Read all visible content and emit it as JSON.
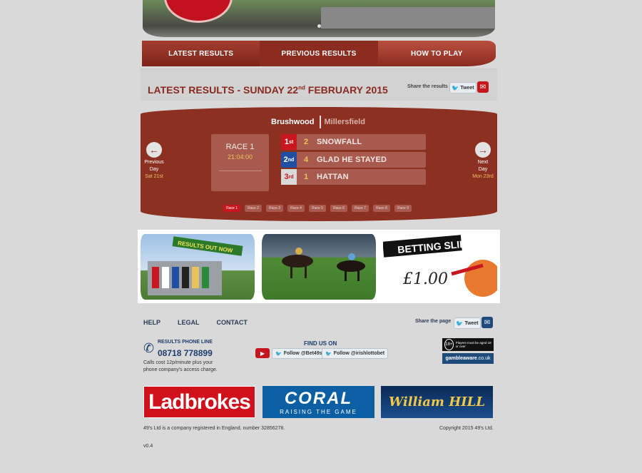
{
  "nav": {
    "tabs": [
      {
        "label": "LATEST RESULTS"
      },
      {
        "label": "PREVIOUS RESULTS"
      },
      {
        "label": "HOW TO PLAY"
      }
    ]
  },
  "latest": {
    "title_prefix": "LATEST RESULTS - ",
    "title_day": "SUNDAY 22",
    "title_sup": "nd",
    "title_rest": " FEBRUARY 2015",
    "share_label": "Share the results",
    "tweet_label": "Tweet"
  },
  "results": {
    "tracks": {
      "active": "Brushwood",
      "inactive": "Millersfield"
    },
    "prev": {
      "line1": "Previous",
      "line2": "Day",
      "date": "Sat 21st"
    },
    "next": {
      "line1": "Next",
      "line2": "Day",
      "date": "Mon 23rd"
    },
    "race": {
      "name": "RACE 1",
      "time": "21:04:00"
    },
    "places": [
      {
        "pos": "1",
        "sup": "st",
        "number": "2",
        "name": "SNOWFALL",
        "color": "#c9161f"
      },
      {
        "pos": "2",
        "sup": "nd",
        "number": "4",
        "name": "GLAD HE STAYED",
        "color": "#1f4fa0"
      },
      {
        "pos": "3",
        "sup": "rd",
        "number": "1",
        "name": "HATTAN",
        "color": "#d9d9d9"
      }
    ],
    "race_links": [
      "Race 1",
      "Race 2",
      "Race 3",
      "Race 4",
      "Race 5",
      "Race 6",
      "Race 7",
      "Race 8",
      "Race 9"
    ]
  },
  "promo": {
    "sign_text": "RESULTS OUT NOW",
    "slip_title": "BETTING SLIP",
    "slip_amount": "£1.00"
  },
  "footer": {
    "links": [
      "HELP",
      "LEGAL",
      "CONTACT"
    ],
    "share_label": "Share the page",
    "tweet_label": "Tweet",
    "phone_title": "RESULTS PHONE LINE",
    "phone_number": "08718 778899",
    "phone_note": "Calls cost 12p/minute plus your phone company's access charge.",
    "find_us": "FIND US ON",
    "follow1": "Follow @Bet49s",
    "follow2": "Follow @irishlottobet",
    "age_badge": "18+",
    "age_text": "Players must be aged 18 or over",
    "gamble_label": "gambleaware",
    "gamble_suffix": ".co.uk",
    "brands": {
      "ladbrokes": "Ladbrokes",
      "coral": "CORAL",
      "coral_sub": "RAISING THE GAME",
      "william_hill": "William HILL"
    },
    "registration": "49's Ltd is a company registered in England, number 32856278.",
    "copyright": "Copyright 2015 49's Ltd.",
    "version": "v0.4"
  }
}
